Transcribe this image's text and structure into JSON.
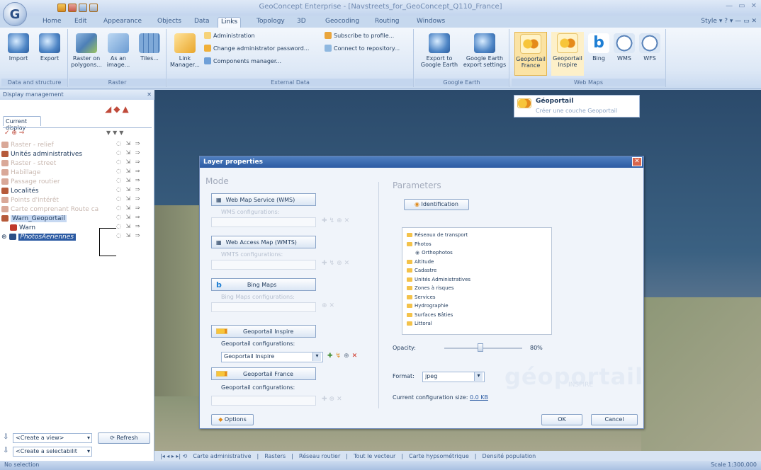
{
  "window": {
    "title": "GeoConcept Enterprise - [Navstreets_for_GeoConcept_Q110_France]",
    "style_label": "Style",
    "app_button": "G"
  },
  "tabs": [
    "Home",
    "Edit",
    "Appearance",
    "Objects",
    "Data",
    "Links",
    "Topology",
    "3D",
    "Geocoding",
    "Routing",
    "Windows"
  ],
  "active_tab": "Links",
  "ribbon": {
    "data_structure": {
      "label": "Data and structure",
      "import": "Import",
      "export": "Export"
    },
    "raster": {
      "label": "Raster",
      "raster_polygons": "Raster on polygons...",
      "as_image": "As an image...",
      "tiles": "Tiles..."
    },
    "external": {
      "label": "External Data",
      "link_manager": "Link Manager...",
      "administration": "Administration",
      "change_pwd": "Change administrator password...",
      "components": "Components manager...",
      "subscribe": "Subscribe to profile...",
      "connect": "Connect to repository..."
    },
    "google": {
      "label": "Google Earth",
      "export_to": "Export to Google Earth",
      "ge_settings": "Google Earth export settings"
    },
    "webmaps": {
      "label": "Web Maps",
      "geo_france": "Geoportail France",
      "geo_inspire": "Geoportail Inspire",
      "bing": "Bing",
      "wms": "WMS",
      "wfs": "WFS"
    }
  },
  "popup": {
    "title": "Géoportail",
    "subtitle": "Créer une couche Geoportail"
  },
  "panel": {
    "title": "Display management",
    "current_display": "Current display",
    "layers": [
      {
        "name": "Raster - relief",
        "faded": true
      },
      {
        "name": "Unités administratives",
        "faded": false
      },
      {
        "name": "Raster - street",
        "faded": true
      },
      {
        "name": "Habillage",
        "faded": true
      },
      {
        "name": "Passage routier",
        "faded": true
      },
      {
        "name": "Localités",
        "faded": false
      },
      {
        "name": "Points d'intérêt",
        "faded": true
      },
      {
        "name": "Carte comprenant Route ca",
        "faded": true
      },
      {
        "name": "Warn_Geoportail",
        "faded": false
      },
      {
        "name": "Warn",
        "faded": false
      },
      {
        "name": "PhotosAeriennes",
        "faded": false
      }
    ],
    "create_view": "<Create a view>",
    "refresh": "Refresh",
    "create_selectable": "<Create a selectabilit"
  },
  "dialog": {
    "title": "Layer properties",
    "mode_heading": "Mode",
    "params_heading": "Parameters",
    "wms": "Web Map Service (WMS)",
    "wms_conf": "WMS configurations:",
    "wmts": "Web Access Map (WMTS)",
    "wmts_conf": "WMTS configurations:",
    "bing": "Bing Maps",
    "bing_conf": "Bing Maps configurations:",
    "geo_inspire": "Geoportail Inspire",
    "geo_inspire_conf": "Geoportail configurations:",
    "geo_inspire_value": "Geoportail Inspire",
    "geo_france": "Geoportail France",
    "geo_france_conf": "Geoportail configurations:",
    "identification": "Identification",
    "tree": [
      "Réseaux de transport",
      "Photos",
      "Orthophotos",
      "Altitude",
      "Cadastre",
      "Unités Administratives",
      "Zones à risques",
      "Services",
      "Hydrographie",
      "Surfaces Bâties",
      "Littoral"
    ],
    "opacity_label": "Opacity:",
    "opacity_value": "80%",
    "opacity_level": 0.8,
    "format_label": "Format:",
    "format_value": "jpeg",
    "config_size_label": "Current configuration size:",
    "config_size_value": "0.0 KB",
    "options": "Options",
    "ok": "OK",
    "cancel": "Cancel",
    "logo": "géoportail",
    "logo_sub": "INSPIRE"
  },
  "map_tabs": [
    "Carte administrative",
    "Rasters",
    "Réseau routier",
    "Tout le vecteur",
    "Carte hypsométrique",
    "Densité population"
  ],
  "status": {
    "left": "No selection",
    "scale": "Scale 1:300,000"
  }
}
